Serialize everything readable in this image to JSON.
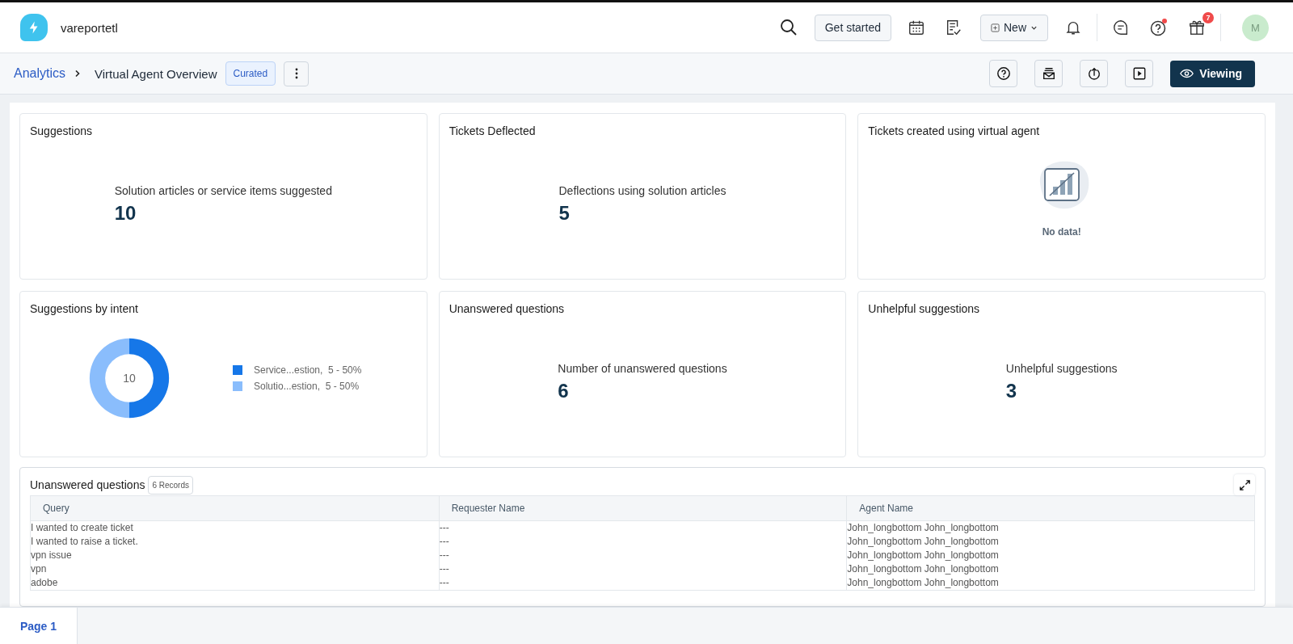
{
  "app": {
    "name": "vareportetl"
  },
  "topbar": {
    "get_started": "Get started",
    "new_button": "New",
    "notification_count": "7",
    "avatar": "M"
  },
  "breadcrumb": {
    "root": "Analytics",
    "current": "Virtual Agent Overview",
    "tag": "Curated"
  },
  "toolbar": {
    "viewing": "Viewing"
  },
  "cards": [
    {
      "kind": "metric",
      "title": "Suggestions",
      "label": "Solution articles or service items suggested",
      "value": "10"
    },
    {
      "kind": "metric",
      "title": "Tickets Deflected",
      "label": "Deflections using solution articles",
      "value": "5"
    },
    {
      "kind": "empty",
      "title": "Tickets created using virtual agent",
      "message": "No data!"
    },
    {
      "kind": "donut",
      "title": "Suggestions by intent",
      "total": "10",
      "chart_data": {
        "type": "donut",
        "categories": [
          "Service...estion,  5 - 50%",
          "Solutio...estion,  5 - 50%"
        ],
        "values": [
          5,
          5
        ],
        "colors": [
          "#1677e8",
          "#8abdfc"
        ]
      }
    },
    {
      "kind": "metric",
      "title": "Unanswered questions",
      "label": "Number of unanswered questions",
      "value": "6"
    },
    {
      "kind": "metric",
      "title": "Unhelpful suggestions",
      "label": "Unhelpful suggestions",
      "value": "3"
    }
  ],
  "table": {
    "title": "Unanswered questions",
    "records": "6 Records",
    "columns": [
      "Query",
      "Requester Name",
      "Agent Name"
    ],
    "rows": [
      [
        "I wanted to create ticket",
        "---",
        "John_longbottom John_longbottom"
      ],
      [
        "I wanted to raise a ticket.",
        "---",
        "John_longbottom John_longbottom"
      ],
      [
        "vpn issue",
        "---",
        "John_longbottom John_longbottom"
      ],
      [
        "vpn",
        "---",
        "John_longbottom John_longbottom"
      ],
      [
        "adobe",
        "---",
        "John_longbottom John_longbottom"
      ]
    ]
  },
  "pages": [
    {
      "label": "Page 1",
      "selected": true
    }
  ]
}
